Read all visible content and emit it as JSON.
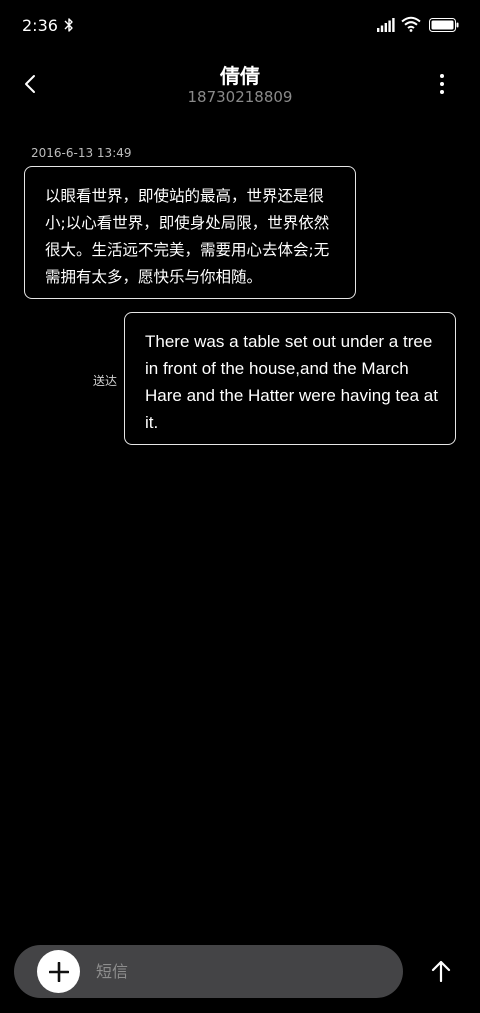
{
  "status_bar": {
    "time": "2:36",
    "icons": [
      "bluetooth-icon",
      "signal-icon",
      "wifi-icon",
      "battery-icon"
    ]
  },
  "header": {
    "contact_name": "倩倩",
    "contact_number": "18730218809",
    "back_icon": "chevron-left-icon",
    "more_icon": "more-vertical-icon"
  },
  "messages": [
    {
      "direction": "incoming",
      "timestamp": "2016-6-13 13:49",
      "text": "以眼看世界，即使站的最高，世界还是很小;以心看世界，即使身处局限，世界依然很大。生活远不完美，需要用心去体会;无需拥有太多，愿快乐与你相随。"
    },
    {
      "direction": "outgoing",
      "status": "送达",
      "text": "There was a table set out under a tree in front of the house,and the March Hare and the Hatter were having tea at it."
    }
  ],
  "composer": {
    "placeholder": "短信",
    "value": "",
    "add_icon": "plus-icon",
    "send_icon": "arrow-up-icon"
  },
  "colors": {
    "background": "#000000",
    "composer_bg": "#444446",
    "bubble_border": "#e6e6e6",
    "secondary_text": "#8a8a8a"
  }
}
